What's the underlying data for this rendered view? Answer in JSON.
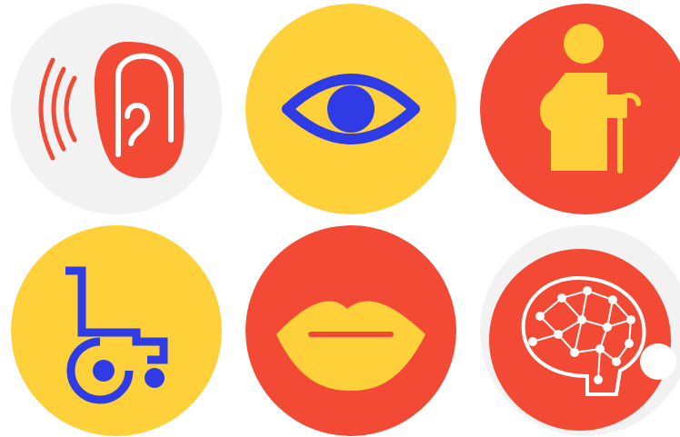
{
  "colors": {
    "red": "#f24a35",
    "yellow": "#fed03a",
    "blue": "#2f3ce6",
    "light_gray": "#f2f2f2",
    "white": "#ffffff"
  },
  "badges": [
    {
      "name": "hearing",
      "icon": "ear-sound-icon",
      "background": "#f2f2f2"
    },
    {
      "name": "vision",
      "icon": "eye-icon",
      "background": "#fed03a"
    },
    {
      "name": "elderly",
      "icon": "elderly-person-cane-icon",
      "background": "#f24a35"
    },
    {
      "name": "mobility",
      "icon": "wheelchair-icon",
      "background": "#fed03a"
    },
    {
      "name": "speech",
      "icon": "lips-icon",
      "background": "#f24a35"
    },
    {
      "name": "cognitive",
      "icon": "brain-network-icon",
      "background": "#f2f2f2"
    }
  ]
}
